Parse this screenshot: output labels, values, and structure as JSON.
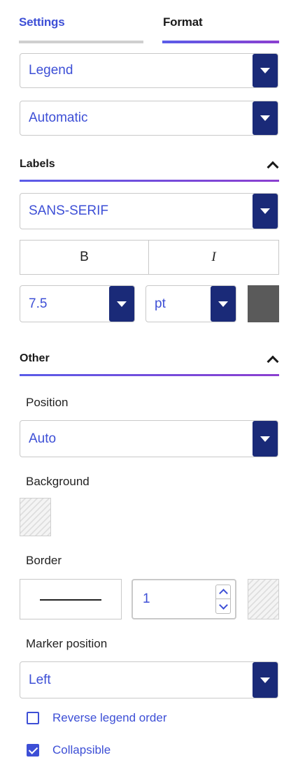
{
  "tabs": {
    "settings": "Settings",
    "format": "Format"
  },
  "chart_component_select": {
    "value": "Legend"
  },
  "mode_select": {
    "value": "Automatic"
  },
  "labels_section": {
    "title": "Labels",
    "font_family": "SANS-SERIF",
    "bold_label": "B",
    "italic_label": "I",
    "font_size": "7.5",
    "font_unit": "pt",
    "font_color": "#5a5a5a"
  },
  "other_section": {
    "title": "Other",
    "position_label": "Position",
    "position_value": "Auto",
    "background_label": "Background",
    "border_label": "Border",
    "border_width": "1",
    "marker_position_label": "Marker position",
    "marker_position_value": "Left",
    "reverse_legend_order": {
      "label": "Reverse legend order",
      "checked": false
    },
    "collapsible": {
      "label": "Collapsible",
      "checked": true
    }
  },
  "colors": {
    "accent": "#3d4fd6",
    "dropdown_button": "#1a2a78",
    "gradient_end": "#8b3fd0"
  }
}
